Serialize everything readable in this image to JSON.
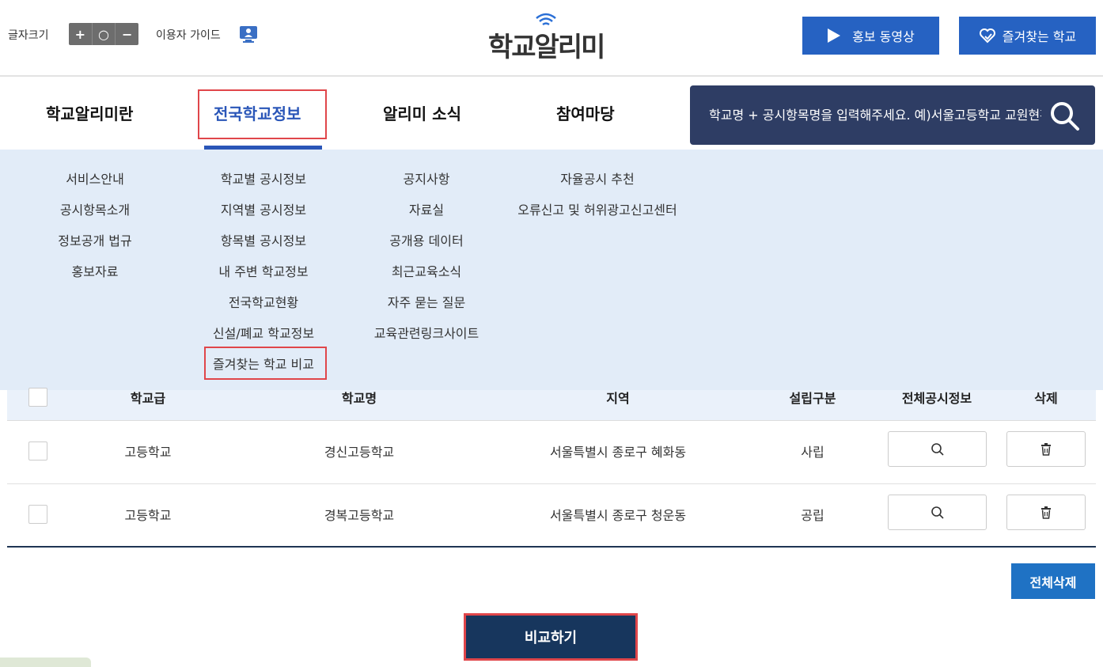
{
  "header": {
    "font_size_label": "글자크기",
    "font_size_buttons": [
      "+",
      "○",
      "−"
    ],
    "guide_label": "이용자 가이드",
    "logo_text": "학교알리미",
    "video_button": "홍보 동영상",
    "favorites_button": "즐겨찾는 학교"
  },
  "nav": {
    "items": [
      "학교알리미란",
      "전국학교정보",
      "알리미 소식",
      "참여마당"
    ],
    "active_index": 1,
    "search_placeholder": "학교명 + 공시항목명을 입력해주세요. 예)서울고등학교 교원현황"
  },
  "dropdown": {
    "columns": [
      [
        "서비스안내",
        "공시항목소개",
        "정보공개 법규",
        "홍보자료"
      ],
      [
        "학교별 공시정보",
        "지역별 공시정보",
        "항목별 공시정보",
        "내 주변 학교정보",
        "전국학교현황",
        "신설/폐교 학교정보",
        "즐겨찾는 학교 비교"
      ],
      [
        "공지사항",
        "자료실",
        "공개용 데이터",
        "최근교육소식",
        "자주 묻는 질문",
        "교육관련링크사이트"
      ],
      [
        "자율공시 추천",
        "오류신고 및 허위광고신고센터"
      ]
    ]
  },
  "table": {
    "headers": [
      "학교급",
      "학교명",
      "지역",
      "설립구분",
      "전체공시정보",
      "삭제"
    ],
    "rows": [
      {
        "level": "고등학교",
        "name": "경신고등학교",
        "region": "서울특별시 종로구 혜화동",
        "type": "사립"
      },
      {
        "level": "고등학교",
        "name": "경복고등학교",
        "region": "서울특별시 종로구 청운동",
        "type": "공립"
      }
    ]
  },
  "actions": {
    "delete_all": "전체삭제",
    "compare": "비교하기"
  },
  "colors": {
    "primary": "#2662c2",
    "nav_active": "#2a56b8",
    "search_bg": "#2e3d64",
    "dropdown_bg": "#e2ecf8",
    "compare_bg": "#17365d",
    "highlight": "#e0464a"
  }
}
